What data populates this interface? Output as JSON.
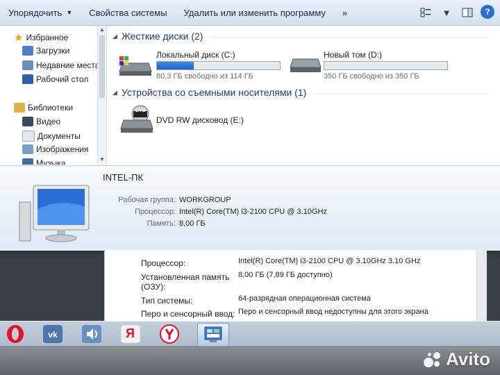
{
  "toolbar": {
    "organize": "Упорядочить",
    "system_props": "Свойства системы",
    "uninstall": "Удалить или изменить программу",
    "more": "»"
  },
  "nav": {
    "favorites": "Избранное",
    "downloads": "Загрузки",
    "recent": "Недавние места",
    "desktop": "Рабочий стол",
    "libraries": "Библиотеки",
    "video": "Видео",
    "documents": "Документы",
    "images": "Изображения",
    "music": "Музыка"
  },
  "content": {
    "hdd_group": "Жесткие диски (2)",
    "removable_group": "Устройства со съемными носителями (1)",
    "drives": [
      {
        "name": "Локальный диск (C:)",
        "free": "80,3 ГБ свободно из 114 ГБ",
        "used_fraction": 0.3
      },
      {
        "name": "Новый том (D:)",
        "free": "350 ГБ свободно из 350 ГБ",
        "used_fraction": 0.0
      }
    ],
    "dvd": {
      "name": "DVD RW дисковод (E:)",
      "icon_text": "DVD"
    }
  },
  "details": {
    "pc_name": "INTEL-ПК",
    "workgroup_label": "Рабочая группа:",
    "workgroup": "WORKGROUP",
    "cpu_label": "Процессор:",
    "cpu": "Intel(R) Core(TM) i3-2100 CPU @ 3.10GHz",
    "ram_label": "Память:",
    "ram": "8,00 ГБ"
  },
  "system": {
    "cpu_label": "Процессор:",
    "cpu": "Intel(R) Core(TM) i3-2100 CPU @ 3.10GHz   3.10 GHz",
    "ram_label_1": "Установленная память",
    "ram_label_2": "(ОЗУ):",
    "ram": "8,00 ГБ (7,89 ГБ доступно)",
    "type_label": "Тип системы:",
    "type": "64-разрядная операционная система",
    "pen_label": "Перо и сенсорный ввод:",
    "pen": "Перо и сенсорный ввод недоступны для этого экрана"
  },
  "taskbar": {
    "yandex_text": "Я"
  },
  "watermark": "Avito"
}
